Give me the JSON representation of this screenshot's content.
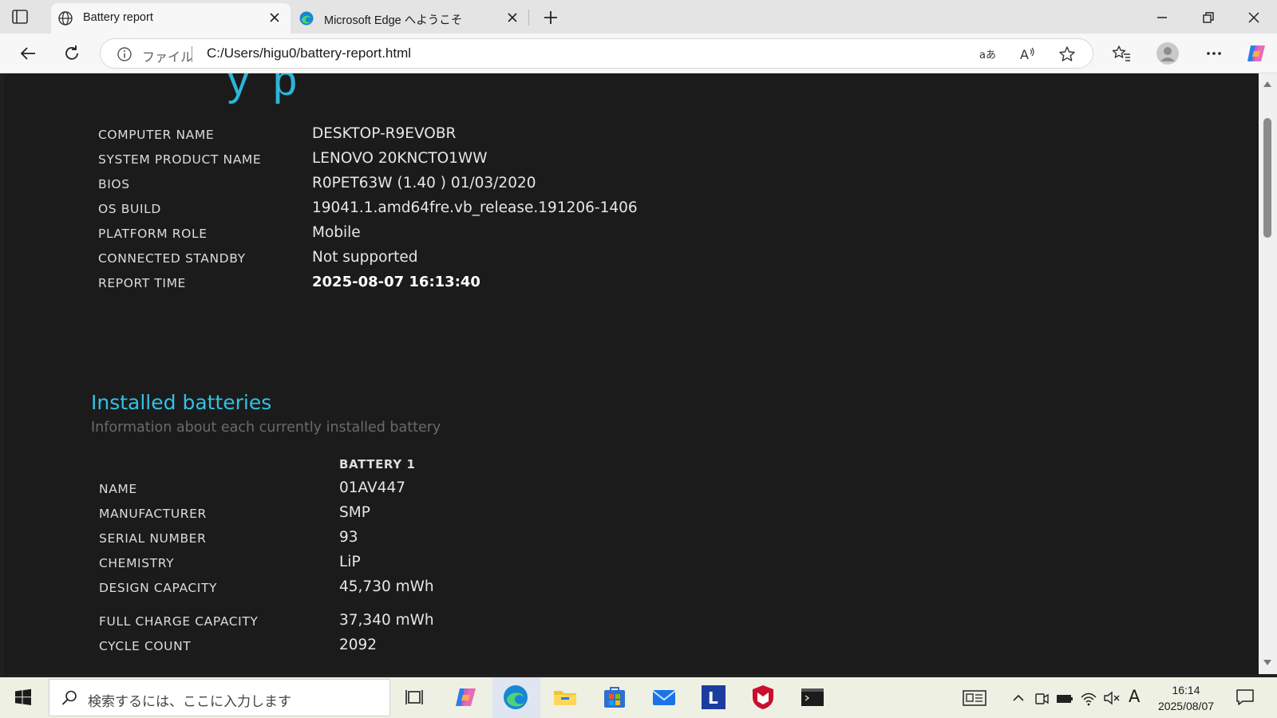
{
  "browser": {
    "tabs": [
      {
        "title": "Battery report"
      },
      {
        "title": "Microsoft Edge へようこそ"
      }
    ],
    "address": {
      "scheme_label": "ファイル",
      "url": "C:/Users/higu0/battery-report.html"
    }
  },
  "system_info": [
    {
      "key": "COMPUTER NAME",
      "value": "DESKTOP-R9EVOBR"
    },
    {
      "key": "SYSTEM PRODUCT NAME",
      "value": "LENOVO 20KNCTO1WW"
    },
    {
      "key": "BIOS",
      "value": "R0PET63W (1.40 ) 01/03/2020"
    },
    {
      "key": "OS BUILD",
      "value": "19041.1.amd64fre.vb_release.191206-1406"
    },
    {
      "key": "PLATFORM ROLE",
      "value": "Mobile"
    },
    {
      "key": "CONNECTED STANDBY",
      "value": "Not supported"
    },
    {
      "key": "REPORT TIME",
      "value": "2025-08-07  16:13:40"
    }
  ],
  "installed_batteries": {
    "title": "Installed batteries",
    "subtitle": "Information about each currently installed battery",
    "column": "BATTERY 1",
    "rows": [
      {
        "key": "NAME",
        "value": "01AV447"
      },
      {
        "key": "MANUFACTURER",
        "value": "SMP"
      },
      {
        "key": "SERIAL NUMBER",
        "value": "93"
      },
      {
        "key": "CHEMISTRY",
        "value": "LiP"
      },
      {
        "key": "DESIGN CAPACITY",
        "value": "45,730 mWh"
      },
      {
        "key": "FULL CHARGE CAPACITY",
        "value": "37,340 mWh"
      },
      {
        "key": "CYCLE COUNT",
        "value": "2092"
      }
    ]
  },
  "taskbar": {
    "search_placeholder": "検索するには、ここに入力します",
    "ime_indicator": "A",
    "time": "16:14",
    "date": "2025/08/07"
  },
  "colors": {
    "accent": "#2ab6d9",
    "page_bg": "#1b1b1b",
    "taskbar_bg": "#eef0e4"
  }
}
